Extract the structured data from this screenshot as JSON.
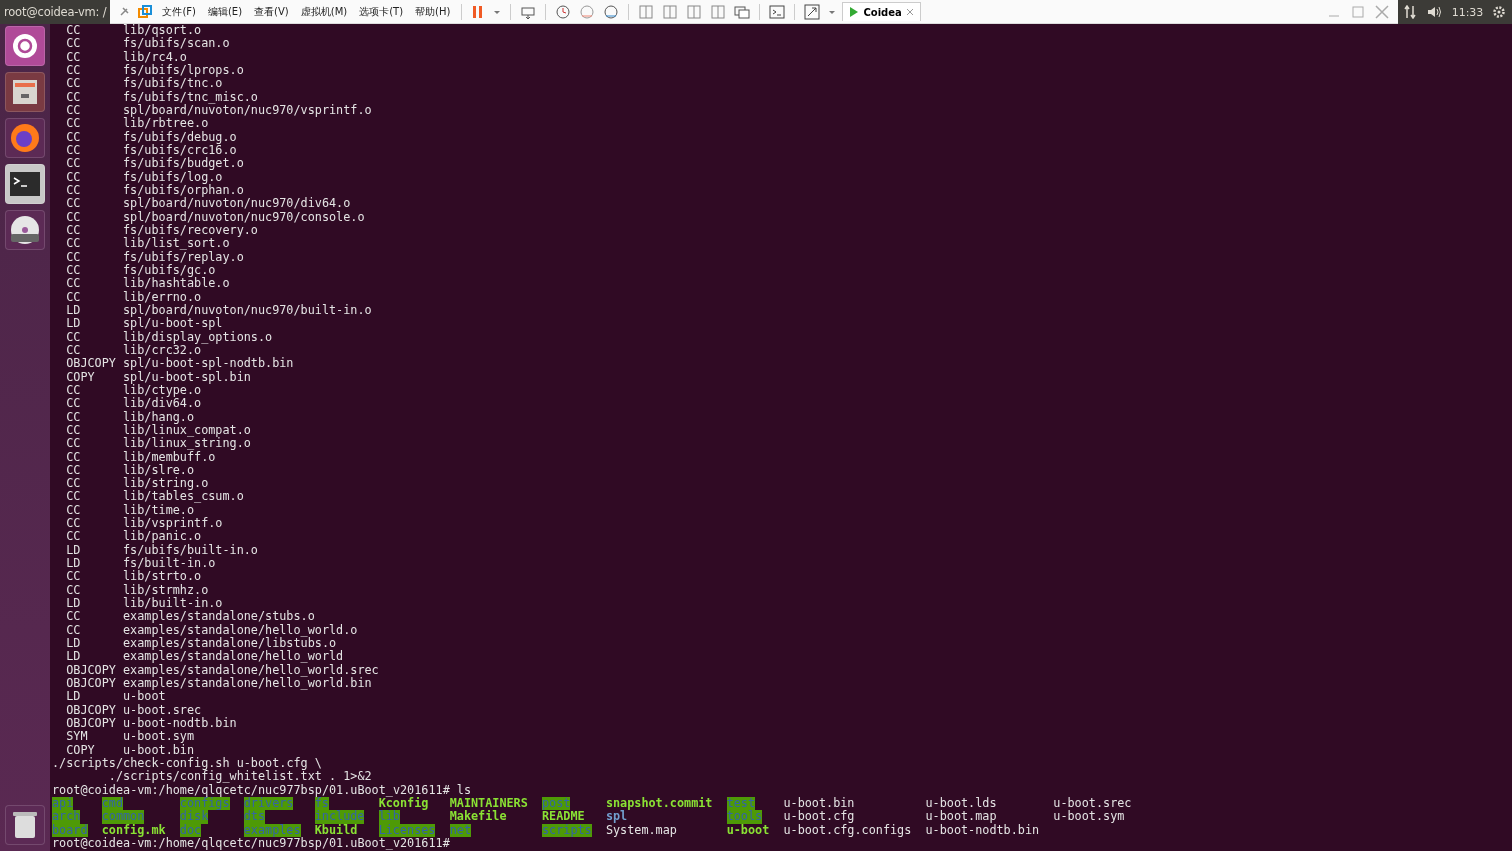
{
  "top_bar": {
    "title": "root@coidea-vm: /",
    "menus": [
      "文件(F)",
      "编辑(E)",
      "查看(V)",
      "虚拟机(M)",
      "选项卡(T)",
      "帮助(H)"
    ],
    "tab": {
      "label": "Coidea"
    },
    "clock": "11:33"
  },
  "terminal": {
    "lines": [
      {
        "kind": "build",
        "tag": "CC",
        "path": "lib/qsort.o"
      },
      {
        "kind": "build",
        "tag": "CC",
        "path": "fs/ubifs/scan.o"
      },
      {
        "kind": "build",
        "tag": "CC",
        "path": "lib/rc4.o"
      },
      {
        "kind": "build",
        "tag": "CC",
        "path": "fs/ubifs/lprops.o"
      },
      {
        "kind": "build",
        "tag": "CC",
        "path": "fs/ubifs/tnc.o"
      },
      {
        "kind": "build",
        "tag": "CC",
        "path": "fs/ubifs/tnc_misc.o"
      },
      {
        "kind": "build",
        "tag": "CC",
        "path": "spl/board/nuvoton/nuc970/vsprintf.o"
      },
      {
        "kind": "build",
        "tag": "CC",
        "path": "lib/rbtree.o"
      },
      {
        "kind": "build",
        "tag": "CC",
        "path": "fs/ubifs/debug.o"
      },
      {
        "kind": "build",
        "tag": "CC",
        "path": "fs/ubifs/crc16.o"
      },
      {
        "kind": "build",
        "tag": "CC",
        "path": "fs/ubifs/budget.o"
      },
      {
        "kind": "build",
        "tag": "CC",
        "path": "fs/ubifs/log.o"
      },
      {
        "kind": "build",
        "tag": "CC",
        "path": "fs/ubifs/orphan.o"
      },
      {
        "kind": "build",
        "tag": "CC",
        "path": "spl/board/nuvoton/nuc970/div64.o"
      },
      {
        "kind": "build",
        "tag": "CC",
        "path": "spl/board/nuvoton/nuc970/console.o"
      },
      {
        "kind": "build",
        "tag": "CC",
        "path": "fs/ubifs/recovery.o"
      },
      {
        "kind": "build",
        "tag": "CC",
        "path": "lib/list_sort.o"
      },
      {
        "kind": "build",
        "tag": "CC",
        "path": "fs/ubifs/replay.o"
      },
      {
        "kind": "build",
        "tag": "CC",
        "path": "fs/ubifs/gc.o"
      },
      {
        "kind": "build",
        "tag": "CC",
        "path": "lib/hashtable.o"
      },
      {
        "kind": "build",
        "tag": "CC",
        "path": "lib/errno.o"
      },
      {
        "kind": "build",
        "tag": "LD",
        "path": "spl/board/nuvoton/nuc970/built-in.o"
      },
      {
        "kind": "build",
        "tag": "LD",
        "path": "spl/u-boot-spl"
      },
      {
        "kind": "build",
        "tag": "CC",
        "path": "lib/display_options.o"
      },
      {
        "kind": "build",
        "tag": "CC",
        "path": "lib/crc32.o"
      },
      {
        "kind": "build",
        "tag": "OBJCOPY",
        "path": "spl/u-boot-spl-nodtb.bin"
      },
      {
        "kind": "build",
        "tag": "COPY",
        "path": "spl/u-boot-spl.bin"
      },
      {
        "kind": "build",
        "tag": "CC",
        "path": "lib/ctype.o"
      },
      {
        "kind": "build",
        "tag": "CC",
        "path": "lib/div64.o"
      },
      {
        "kind": "build",
        "tag": "CC",
        "path": "lib/hang.o"
      },
      {
        "kind": "build",
        "tag": "CC",
        "path": "lib/linux_compat.o"
      },
      {
        "kind": "build",
        "tag": "CC",
        "path": "lib/linux_string.o"
      },
      {
        "kind": "build",
        "tag": "CC",
        "path": "lib/membuff.o"
      },
      {
        "kind": "build",
        "tag": "CC",
        "path": "lib/slre.o"
      },
      {
        "kind": "build",
        "tag": "CC",
        "path": "lib/string.o"
      },
      {
        "kind": "build",
        "tag": "CC",
        "path": "lib/tables_csum.o"
      },
      {
        "kind": "build",
        "tag": "CC",
        "path": "lib/time.o"
      },
      {
        "kind": "build",
        "tag": "CC",
        "path": "lib/vsprintf.o"
      },
      {
        "kind": "build",
        "tag": "CC",
        "path": "lib/panic.o"
      },
      {
        "kind": "build",
        "tag": "LD",
        "path": "fs/ubifs/built-in.o"
      },
      {
        "kind": "build",
        "tag": "LD",
        "path": "fs/built-in.o"
      },
      {
        "kind": "build",
        "tag": "CC",
        "path": "lib/strto.o"
      },
      {
        "kind": "build",
        "tag": "CC",
        "path": "lib/strmhz.o"
      },
      {
        "kind": "build",
        "tag": "LD",
        "path": "lib/built-in.o"
      },
      {
        "kind": "build",
        "tag": "CC",
        "path": "examples/standalone/stubs.o"
      },
      {
        "kind": "build",
        "tag": "CC",
        "path": "examples/standalone/hello_world.o"
      },
      {
        "kind": "build",
        "tag": "LD",
        "path": "examples/standalone/libstubs.o"
      },
      {
        "kind": "build",
        "tag": "LD",
        "path": "examples/standalone/hello_world"
      },
      {
        "kind": "build",
        "tag": "OBJCOPY",
        "path": "examples/standalone/hello_world.srec"
      },
      {
        "kind": "build",
        "tag": "OBJCOPY",
        "path": "examples/standalone/hello_world.bin"
      },
      {
        "kind": "build",
        "tag": "LD",
        "path": "u-boot"
      },
      {
        "kind": "build",
        "tag": "OBJCOPY",
        "path": "u-boot.srec"
      },
      {
        "kind": "build",
        "tag": "OBJCOPY",
        "path": "u-boot-nodtb.bin"
      },
      {
        "kind": "build",
        "tag": "SYM",
        "path": "u-boot.sym"
      },
      {
        "kind": "build",
        "tag": "COPY",
        "path": "u-boot.bin"
      },
      {
        "kind": "plain",
        "text": "./scripts/check-config.sh u-boot.cfg \\"
      },
      {
        "kind": "plain",
        "text": "        ./scripts/config_whitelist.txt . 1>&2"
      },
      {
        "kind": "plain",
        "text": "root@coidea-vm:/home/qlqcetc/nuc977bsp/01.uBoot_v201611# ls"
      }
    ],
    "listing": [
      [
        {
          "name": "api",
          "kind": "shared-dir"
        },
        {
          "name": "cmd",
          "kind": "shared-dir"
        },
        {
          "name": "configs",
          "kind": "shared-dir"
        },
        {
          "name": "drivers",
          "kind": "shared-dir"
        },
        {
          "name": "fs",
          "kind": "shared-dir"
        },
        {
          "name": "Kconfig",
          "kind": "exec"
        },
        {
          "name": "MAINTAINERS",
          "kind": "exec"
        },
        {
          "name": "post",
          "kind": "shared-dir"
        },
        {
          "name": "snapshot.commit",
          "kind": "exec"
        },
        {
          "name": "test",
          "kind": "shared-dir"
        },
        {
          "name": "u-boot.bin",
          "kind": "file"
        },
        {
          "name": "u-boot.lds",
          "kind": "file"
        },
        {
          "name": "u-boot.srec",
          "kind": "file"
        }
      ],
      [
        {
          "name": "arch",
          "kind": "shared-dir"
        },
        {
          "name": "common",
          "kind": "shared-dir"
        },
        {
          "name": "disk",
          "kind": "shared-dir"
        },
        {
          "name": "dts",
          "kind": "shared-dir"
        },
        {
          "name": "include",
          "kind": "shared-dir"
        },
        {
          "name": "lib",
          "kind": "shared-dir"
        },
        {
          "name": "Makefile",
          "kind": "exec"
        },
        {
          "name": "README",
          "kind": "exec"
        },
        {
          "name": "spl",
          "kind": "dir"
        },
        {
          "name": "tools",
          "kind": "shared-dir"
        },
        {
          "name": "u-boot.cfg",
          "kind": "file"
        },
        {
          "name": "u-boot.map",
          "kind": "file"
        },
        {
          "name": "u-boot.sym",
          "kind": "file"
        }
      ],
      [
        {
          "name": "board",
          "kind": "shared-dir"
        },
        {
          "name": "config.mk",
          "kind": "exec"
        },
        {
          "name": "doc",
          "kind": "shared-dir"
        },
        {
          "name": "examples",
          "kind": "shared-dir"
        },
        {
          "name": "Kbuild",
          "kind": "exec"
        },
        {
          "name": "Licenses",
          "kind": "shared-dir"
        },
        {
          "name": "net",
          "kind": "shared-dir"
        },
        {
          "name": "scripts",
          "kind": "shared-dir"
        },
        {
          "name": "System.map",
          "kind": "file"
        },
        {
          "name": "u-boot",
          "kind": "exec"
        },
        {
          "name": "u-boot.cfg.configs",
          "kind": "file"
        },
        {
          "name": "u-boot-nodtb.bin",
          "kind": "file"
        }
      ]
    ],
    "prompt": "root@coidea-vm:/home/qlqcetc/nuc977bsp/01.uBoot_v201611#"
  }
}
